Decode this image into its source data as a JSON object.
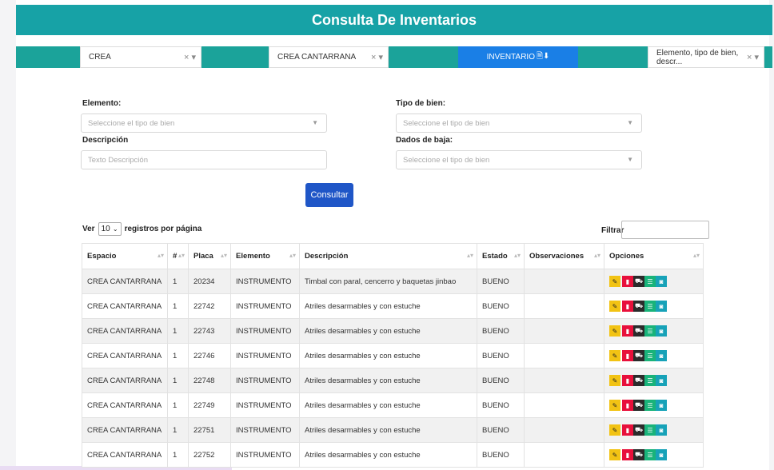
{
  "header": {
    "title": "Consulta De Inventarios"
  },
  "filter_bar": {
    "select1": {
      "value": "CREA",
      "controls": "× ▾"
    },
    "select2": {
      "value": "CREA CANTARRANA",
      "controls": "× ▾"
    },
    "inventory_button": {
      "label": "INVENTARIO",
      "icons": "🗎⬇"
    },
    "select3": {
      "value": "Elemento, tipo de bien, descr...",
      "controls": "× ▾"
    }
  },
  "form": {
    "elemento_label": "Elemento:",
    "elemento_placeholder": "Seleccione el tipo de bien",
    "tipo_bien_label": "Tipo de bien:",
    "tipo_bien_placeholder": "Seleccione el tipo de bien",
    "descripcion_label": "Descripción",
    "descripcion_placeholder": "Texto Descripción",
    "dados_baja_label": "Dados de baja:",
    "dados_baja_placeholder": "Seleccione el tipo de bien",
    "consultar_label": "Consultar"
  },
  "table_controls": {
    "ver": "Ver",
    "page_length": "10",
    "per_page_text": "registros por página",
    "filtrar": "Filtrar"
  },
  "table": {
    "headers": [
      "Espacio",
      "#",
      "Placa",
      "Elemento",
      "Descripción",
      "Estado",
      "Observaciones",
      "Opciones"
    ],
    "rows": [
      [
        "CREA CANTARRANA",
        "1",
        "20234",
        "INSTRUMENTO",
        "Timbal con paral, cencerro y baquetas jinbao",
        "BUENO",
        ""
      ],
      [
        "CREA CANTARRANA",
        "1",
        "22742",
        "INSTRUMENTO",
        "Atriles desarmables y con estuche",
        "BUENO",
        ""
      ],
      [
        "CREA CANTARRANA",
        "1",
        "22743",
        "INSTRUMENTO",
        "Atriles desarmables y con estuche",
        "BUENO",
        ""
      ],
      [
        "CREA CANTARRANA",
        "1",
        "22746",
        "INSTRUMENTO",
        "Atriles desarmables y con estuche",
        "BUENO",
        ""
      ],
      [
        "CREA CANTARRANA",
        "1",
        "22748",
        "INSTRUMENTO",
        "Atriles desarmables y con estuche",
        "BUENO",
        ""
      ],
      [
        "CREA CANTARRANA",
        "1",
        "22749",
        "INSTRUMENTO",
        "Atriles desarmables y con estuche",
        "BUENO",
        ""
      ],
      [
        "CREA CANTARRANA",
        "1",
        "22751",
        "INSTRUMENTO",
        "Atriles desarmables y con estuche",
        "BUENO",
        ""
      ],
      [
        "CREA CANTARRANA",
        "1",
        "22752",
        "INSTRUMENTO",
        "Atriles desarmables y con estuche",
        "BUENO",
        ""
      ]
    ]
  },
  "icons": {
    "edit": "edit-icon",
    "delete": "trash-icon",
    "view": "car-icon",
    "list": "list-icon",
    "camera": "camera-icon"
  },
  "colors": {
    "header": "#17a2a6",
    "filter_bar": "#1ba39a",
    "inventory_button": "#1a7fe6",
    "consultar_button": "#1f56c7",
    "edit": "#f2c314",
    "delete": "#e8103b",
    "view": "#2b2b2b",
    "list": "#19b37a",
    "camera": "#17a2b8"
  }
}
